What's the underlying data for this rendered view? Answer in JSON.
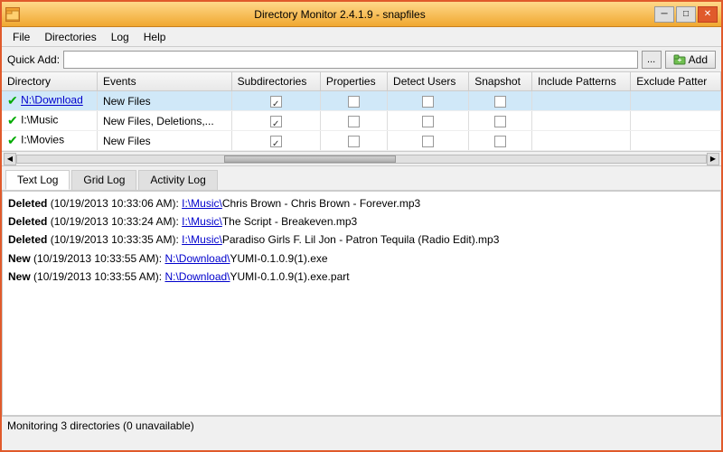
{
  "window": {
    "title": "Directory Monitor 2.4.1.9 - snapfiles",
    "icon": "📁"
  },
  "window_controls": {
    "minimize": "─",
    "maximize": "□",
    "close": "✕"
  },
  "menu": {
    "items": [
      "File",
      "Directories",
      "Log",
      "Help"
    ]
  },
  "quick_add": {
    "label": "Quick Add:",
    "input_value": "",
    "browse_label": "...",
    "add_label": "Add",
    "add_icon": "➕"
  },
  "table": {
    "columns": [
      "Directory",
      "Events",
      "Subdirectories",
      "Properties",
      "Detect Users",
      "Snapshot",
      "Include Patterns",
      "Exclude Pattern"
    ],
    "rows": [
      {
        "icon": "✔",
        "directory": "N:\\Download",
        "events": "New Files",
        "subdirectories": true,
        "properties": false,
        "detect_users": false,
        "snapshot": false,
        "highlighted": true
      },
      {
        "icon": "✔",
        "directory": "I:\\Music",
        "events": "New Files, Deletions,...",
        "subdirectories": true,
        "properties": false,
        "detect_users": false,
        "snapshot": false,
        "highlighted": false
      },
      {
        "icon": "✔",
        "directory": "I:\\Movies",
        "events": "New Files",
        "subdirectories": true,
        "properties": false,
        "detect_users": false,
        "snapshot": false,
        "highlighted": false
      }
    ]
  },
  "tabs": {
    "items": [
      "Text Log",
      "Grid Log",
      "Activity Log"
    ],
    "active": 0
  },
  "log": {
    "entries": [
      {
        "type": "Deleted",
        "timestamp": "(10/19/2013 10:33:06 AM):",
        "path_prefix": "I:\\Music\\",
        "path_link": "I:\\Music\\",
        "filename": "Chris Brown - Chris Brown - Forever.mp3"
      },
      {
        "type": "Deleted",
        "timestamp": "(10/19/2013 10:33:24 AM):",
        "path_prefix": "I:\\Music\\",
        "path_link": "I:\\Music\\",
        "filename": "The Script - Breakeven.mp3"
      },
      {
        "type": "Deleted",
        "timestamp": "(10/19/2013 10:33:35 AM):",
        "path_prefix": "I:\\Music\\",
        "path_link": "I:\\Music\\",
        "filename": "Paradiso Girls F. Lil Jon - Patron Tequila (Radio Edit).mp3"
      },
      {
        "type": "New",
        "timestamp": "(10/19/2013 10:33:55 AM):",
        "path_prefix": "N:\\Download\\",
        "path_link": "N:\\Download\\",
        "filename": "YUMI-0.1.0.9(1).exe"
      },
      {
        "type": "New",
        "timestamp": "(10/19/2013 10:33:55 AM):",
        "path_prefix": "N:\\Download\\",
        "path_link": "N:\\Download\\",
        "filename": "YUMI-0.1.0.9(1).exe.part"
      }
    ]
  },
  "status_bar": {
    "text": "Monitoring 3 directories (0 unavailable)"
  }
}
